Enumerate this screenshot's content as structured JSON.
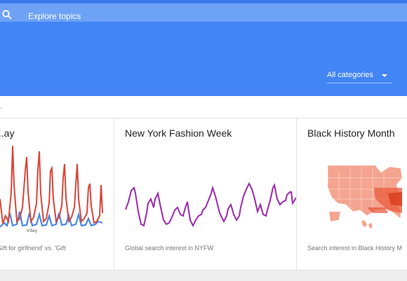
{
  "header": {
    "search_placeholder": "Explore topics",
    "category_label": "All categories",
    "accent_color": "#4285f4"
  },
  "subheader": {
    "glyph": "."
  },
  "cards": [
    {
      "title": "...ay",
      "caption": "'Gift for girlfriend' vs. 'Gift",
      "chart_icon": "line-chart-icon"
    },
    {
      "title": "New York Fashion Week",
      "caption": "Global search interest in NYFW",
      "chart_icon": "line-chart-icon"
    },
    {
      "title": "Black History Month",
      "caption": "Search interest in Black History M",
      "chart_icon": "us-map-icon"
    }
  ]
}
